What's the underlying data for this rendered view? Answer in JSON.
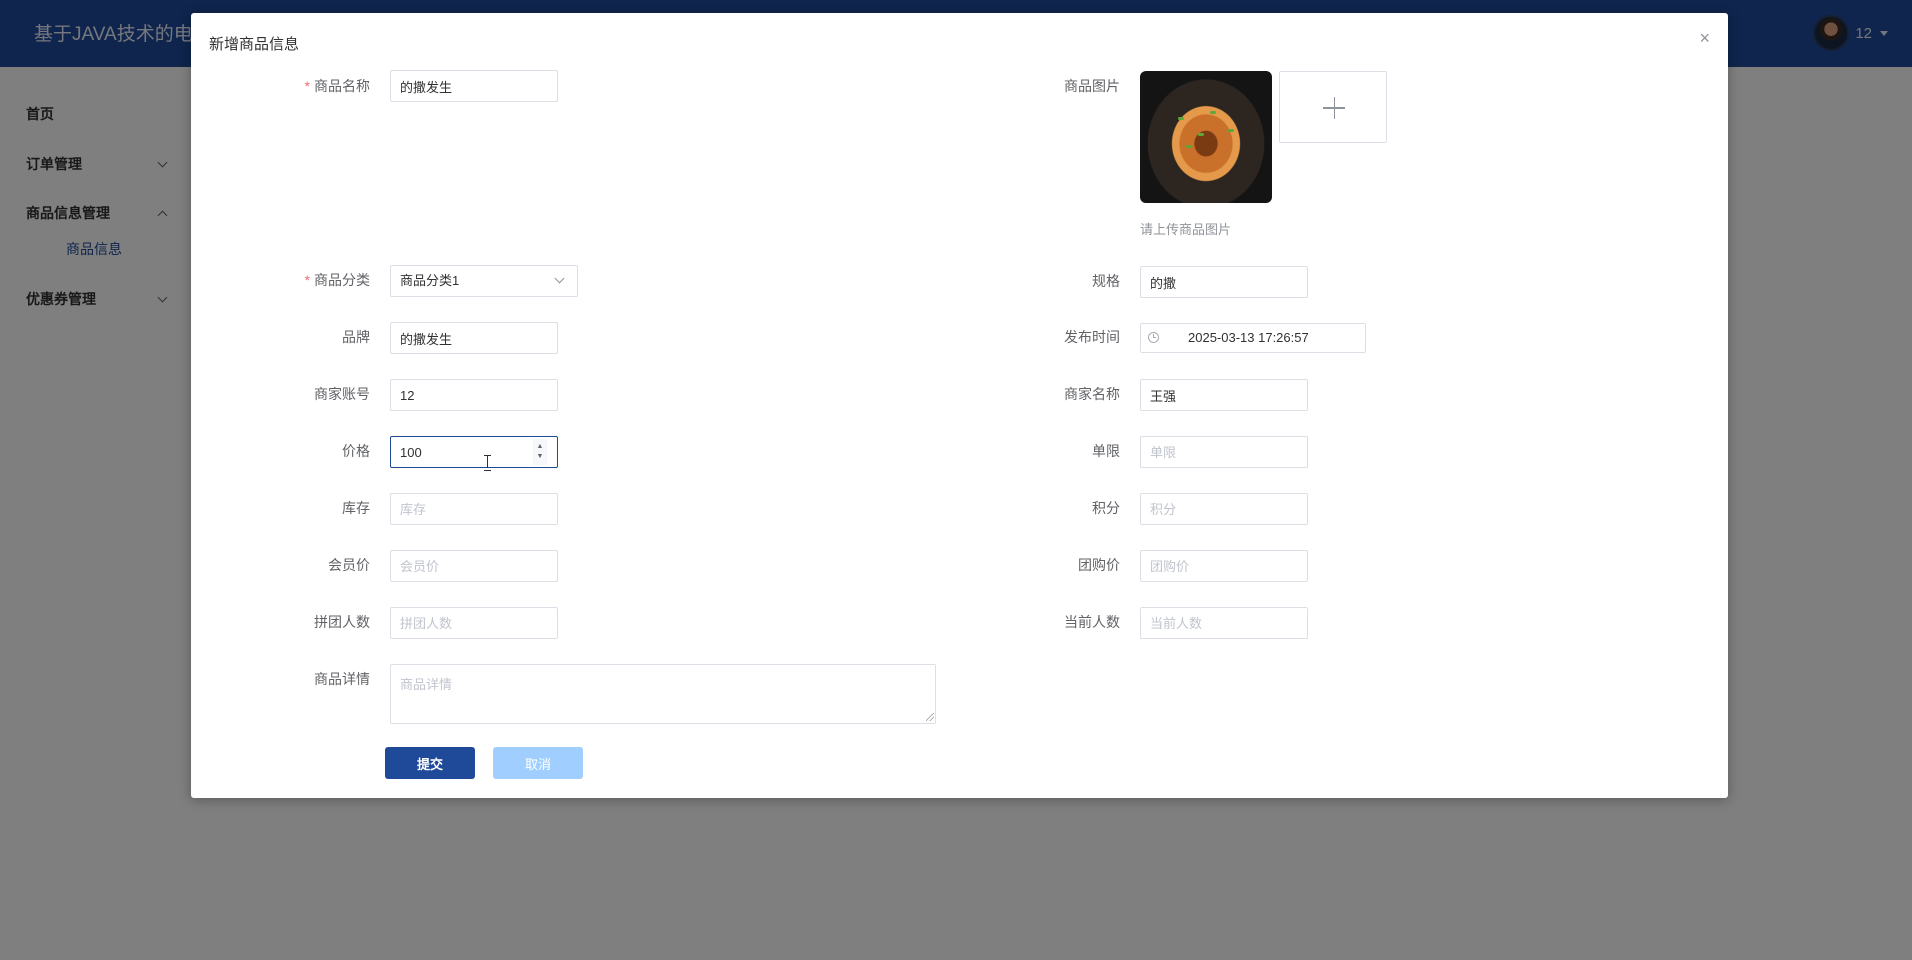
{
  "header": {
    "app_title": "基于JAVA技术的电",
    "user_name": "12"
  },
  "sidebar": {
    "items": [
      {
        "label": "首页"
      },
      {
        "label": "订单管理"
      },
      {
        "label": "商品信息管理",
        "sub_items": [
          {
            "label": "商品信息"
          }
        ]
      },
      {
        "label": "优惠券管理"
      }
    ]
  },
  "dialog": {
    "title": "新增商品信息",
    "close_symbol": "×",
    "fields": {
      "name": {
        "label": "商品名称",
        "value": "的撒发生",
        "required": true
      },
      "image": {
        "label": "商品图片",
        "tip": "请上传商品图片"
      },
      "category": {
        "label": "商品分类",
        "value": "商品分类1",
        "required": true
      },
      "spec": {
        "label": "规格",
        "value": "的撒"
      },
      "brand": {
        "label": "品牌",
        "value": "的撒发生"
      },
      "publish_time": {
        "label": "发布时间",
        "value": "2025-03-13 17:26:57"
      },
      "merchant_account": {
        "label": "商家账号",
        "value": "12"
      },
      "merchant_name": {
        "label": "商家名称",
        "value": "王强"
      },
      "price": {
        "label": "价格",
        "value": "100"
      },
      "limit": {
        "label": "单限",
        "placeholder": "单限"
      },
      "stock": {
        "label": "库存",
        "placeholder": "库存"
      },
      "points": {
        "label": "积分",
        "placeholder": "积分"
      },
      "member_price": {
        "label": "会员价",
        "placeholder": "会员价"
      },
      "group_price": {
        "label": "团购价",
        "placeholder": "团购价"
      },
      "group_size": {
        "label": "拼团人数",
        "placeholder": "拼团人数"
      },
      "current_size": {
        "label": "当前人数",
        "placeholder": "当前人数"
      },
      "detail": {
        "label": "商品详情",
        "placeholder": "商品详情"
      }
    },
    "buttons": {
      "submit": "提交",
      "cancel": "取消"
    }
  },
  "colors": {
    "brand": "#1f4a9a",
    "required_mark": "#f56c6c",
    "disabled_button": "#a0cfff"
  },
  "icons": [
    "avatar",
    "chevron-down-icon",
    "chevron-up-icon",
    "close-icon",
    "clock-icon",
    "plus-icon",
    "number-stepper-icon"
  ]
}
